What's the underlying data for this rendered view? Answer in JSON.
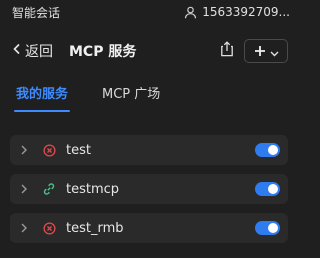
{
  "topbar": {
    "title": "智能会话",
    "user_id": "1563392709...",
    "user_icon": "user-icon"
  },
  "header": {
    "back_label": "返回",
    "title": "MCP 服务",
    "export_icon": "export-icon",
    "add_icon": "plus-icon",
    "add_menu_icon": "chevron-down-icon"
  },
  "tabs": [
    {
      "label": "我的服务",
      "active": true
    },
    {
      "label": "MCP 广场",
      "active": false
    }
  ],
  "services": [
    {
      "name": "test",
      "status": "error",
      "enabled": true
    },
    {
      "name": "testmcp",
      "status": "connected",
      "enabled": true
    },
    {
      "name": "test_rmb",
      "status": "error",
      "enabled": true
    }
  ],
  "colors": {
    "accent": "#3d8bff",
    "error": "#e5484d",
    "connected": "#4cc38a",
    "background": "#1f1f1f",
    "card": "#2a2a2a"
  }
}
